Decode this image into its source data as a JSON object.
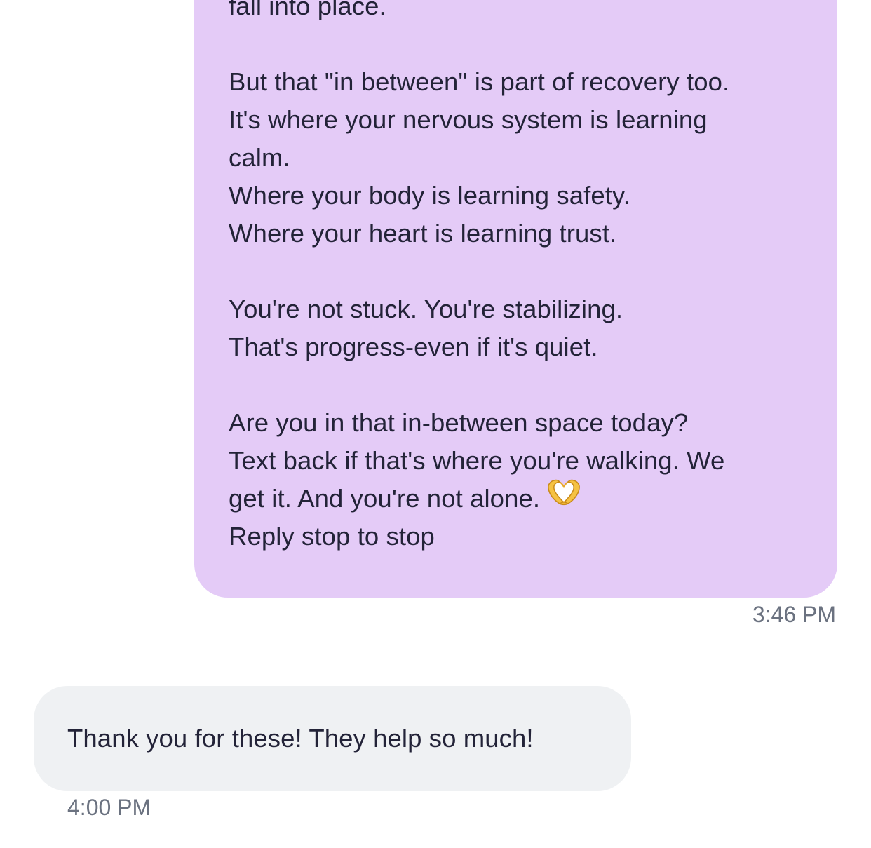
{
  "conversation": {
    "sent_message": {
      "lines": [
        "fall into place.",
        "",
        "But that \"in between\" is part of recovery too.",
        "It's where your nervous system is learning",
        "calm.",
        "Where your body is learning safety.",
        "Where your heart is learning trust.",
        "",
        "You're not stuck. You're stabilizing.",
        "That's progress-even if it's quiet.",
        "",
        "Are you in that in-between space today?",
        "Text back if that's where you're walking. We",
        "get it. And you're not alone.",
        "Reply stop to stop"
      ],
      "emoji_icon": "heart-hands-icon",
      "timestamp": "3:46 PM",
      "bubble_color": "#e4cbf7"
    },
    "received_message": {
      "text": "Thank you for these! They help so much!",
      "timestamp": "4:00 PM",
      "bubble_color": "#eff1f3"
    },
    "text_color": "#232338",
    "timestamp_color": "#6b7280"
  }
}
